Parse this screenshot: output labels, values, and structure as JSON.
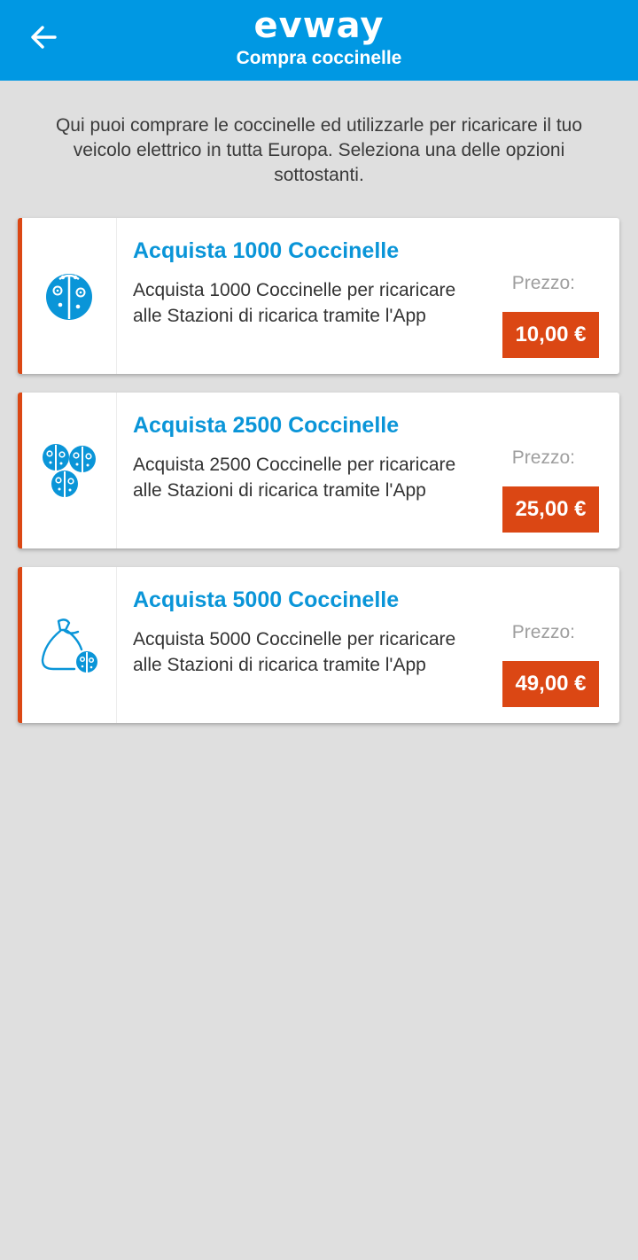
{
  "header": {
    "logo": "evway",
    "subtitle": "Compra coccinelle"
  },
  "intro": "Qui puoi comprare le coccinelle ed utilizzarle per ricaricare il tuo veicolo elettrico in tutta Europa. Seleziona una delle opzioni sottostanti.",
  "products": [
    {
      "icon": "ladybug-icon",
      "title": "Acquista 1000 Coccinelle",
      "description": "Acquista 1000 Coccinelle per ricaricare alle Stazioni di ricarica tramite l'App",
      "price_label": "Prezzo:",
      "price": "10,00 €"
    },
    {
      "icon": "ladybugs-group-icon",
      "title": "Acquista 2500 Coccinelle",
      "description": "Acquista 2500 Coccinelle per ricaricare alle Stazioni di ricarica tramite l'App",
      "price_label": "Prezzo:",
      "price": "25,00 €"
    },
    {
      "icon": "ladybug-bag-icon",
      "title": "Acquista 5000 Coccinelle",
      "description": "Acquista 5000 Coccinelle per ricaricare alle Stazioni di ricarica tramite l'App",
      "price_label": "Prezzo:",
      "price": "49,00 €"
    }
  ],
  "colors": {
    "header": "#0098e3",
    "accent": "#db4714",
    "title": "#0a95d8",
    "background": "#dfdfdf"
  }
}
